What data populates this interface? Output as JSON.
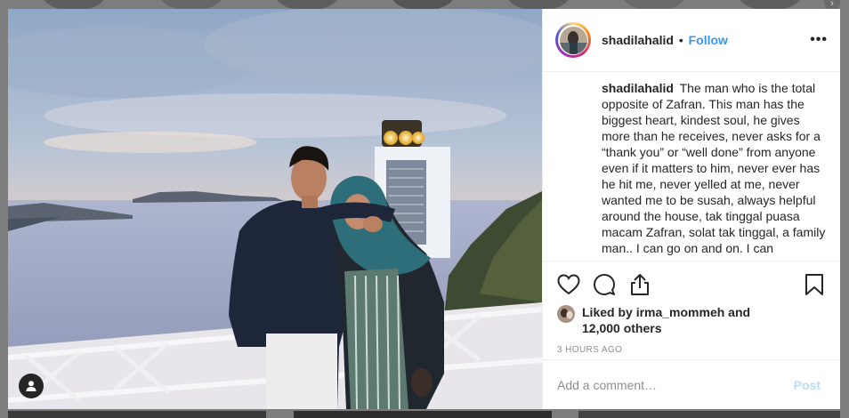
{
  "post": {
    "username": "shadilahalid",
    "separator": "•",
    "follow_label": "Follow",
    "more_label": "•••",
    "caption_username": "shadilahalid",
    "caption_text": "The man who is the total opposite of Zafran. This man has the biggest heart, kindest soul, he gives more than he receives, never asks for a “thank you” or “well done” from anyone even if it matters to him, never ever has he hit me, never yelled at me, never wanted me to be susah, always helpful around the house, tak tinggal puasa macam Zafran, solat tak tinggal, a family man.. I can go on and on. I can",
    "liked_by_prefix": "Liked by ",
    "liked_by_user": "irma_mommeh",
    "liked_by_and": " and",
    "liked_by_others": "12,000 others",
    "timestamp": "3 HOURS AGO"
  },
  "comment": {
    "placeholder": "Add a comment…",
    "post_label": "Post"
  },
  "background": {
    "next_arrow": "›"
  },
  "colors": {
    "link_blue": "#3897f0",
    "post_disabled": "#b2dffc",
    "text": "#262626",
    "muted": "#8e8e8e"
  },
  "icons": [
    "heart-icon",
    "comment-icon",
    "share-icon",
    "bookmark-icon",
    "user-tag-icon"
  ]
}
